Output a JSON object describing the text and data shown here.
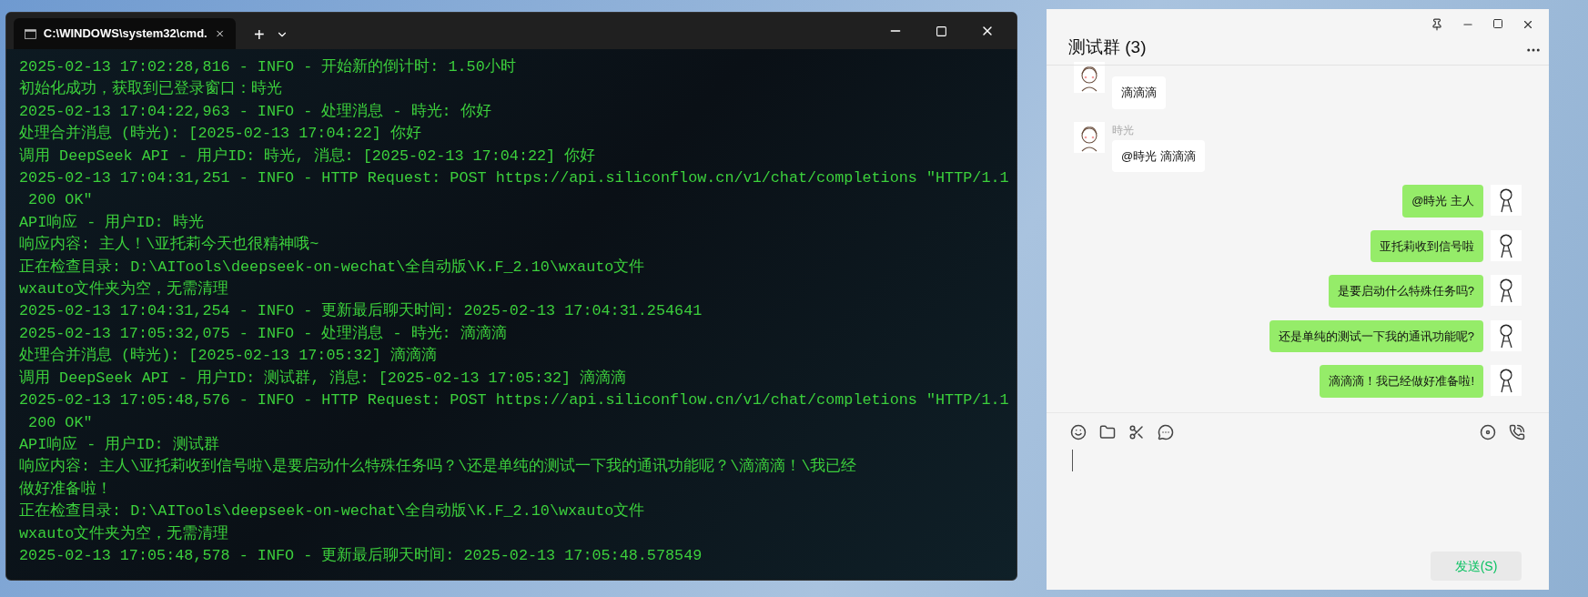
{
  "terminal": {
    "tab_title": "C:\\WINDOWS\\system32\\cmd.",
    "new_tab": "+",
    "lines": [
      "2025-02-13 17:02:28,816 - INFO - 开始新的倒计时: 1.50小时",
      "初始化成功，获取到已登录窗口：時光",
      "2025-02-13 17:04:22,963 - INFO - 处理消息 - 時光: 你好",
      "处理合并消息 (時光): [2025-02-13 17:04:22] 你好",
      "调用 DeepSeek API - 用户ID: 時光, 消息: [2025-02-13 17:04:22] 你好",
      "2025-02-13 17:04:31,251 - INFO - HTTP Request: POST https://api.siliconflow.cn/v1/chat/completions \"HTTP/1.1",
      " 200 OK\"",
      "API响应 - 用户ID: 時光",
      "响应内容: 主人！\\亚托莉今天也很精神哦~",
      "正在检查目录: D:\\AITools\\deepseek-on-wechat\\全自动版\\K.F_2.10\\wxauto文件",
      "wxauto文件夹为空，无需清理",
      "2025-02-13 17:04:31,254 - INFO - 更新最后聊天时间: 2025-02-13 17:04:31.254641",
      "2025-02-13 17:05:32,075 - INFO - 处理消息 - 時光: 滴滴滴",
      "处理合并消息 (時光): [2025-02-13 17:05:32] 滴滴滴",
      "调用 DeepSeek API - 用户ID: 测试群, 消息: [2025-02-13 17:05:32] 滴滴滴",
      "2025-02-13 17:05:48,576 - INFO - HTTP Request: POST https://api.siliconflow.cn/v1/chat/completions \"HTTP/1.1",
      " 200 OK\"",
      "API响应 - 用户ID: 测试群",
      "响应内容: 主人\\亚托莉收到信号啦\\是要启动什么特殊任务吗？\\还是单纯的测试一下我的通讯功能呢？\\滴滴滴！\\我已经",
      "做好准备啦！",
      "正在检查目录: D:\\AITools\\deepseek-on-wechat\\全自动版\\K.F_2.10\\wxauto文件",
      "wxauto文件夹为空，无需清理",
      "2025-02-13 17:05:48,578 - INFO - 更新最后聊天时间: 2025-02-13 17:05:48.578549"
    ]
  },
  "chat": {
    "title": "测试群 (3)",
    "messages": [
      {
        "self": false,
        "text": "滴滴滴"
      },
      {
        "self": false,
        "sender": "時光",
        "text": "@時光 滴滴滴"
      },
      {
        "self": true,
        "text": "@時光 主人"
      },
      {
        "self": true,
        "text": "亚托莉收到信号啦"
      },
      {
        "self": true,
        "text": "是要启动什么特殊任务吗?"
      },
      {
        "self": true,
        "text": "还是单纯的测试一下我的通讯功能呢?"
      },
      {
        "self": true,
        "text": "滴滴滴！我已经做好准备啦!"
      }
    ],
    "send_button": "发送(S)"
  }
}
